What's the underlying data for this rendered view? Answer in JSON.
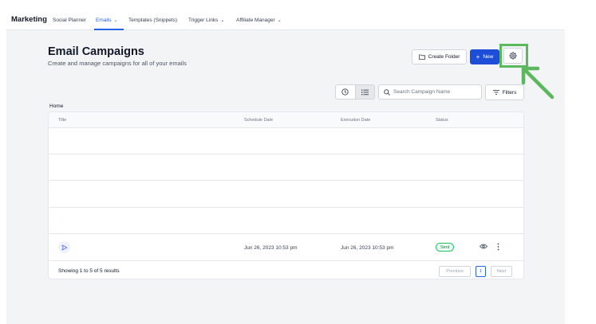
{
  "nav": {
    "brand": "Marketing",
    "items": [
      {
        "label": "Social Planner",
        "active": false,
        "has_chevron": false
      },
      {
        "label": "Emails",
        "active": true,
        "has_chevron": true
      },
      {
        "label": "Templates (Snippets)",
        "active": false,
        "has_chevron": false
      },
      {
        "label": "Trigger Links",
        "active": false,
        "has_chevron": true
      },
      {
        "label": "Affiliate Manager",
        "active": false,
        "has_chevron": true
      }
    ]
  },
  "header": {
    "title": "Email Campaigns",
    "subtitle": "Create and manage campaigns for all of your emails",
    "create_folder_label": "Create Folder",
    "new_label": "New"
  },
  "filters": {
    "search_placeholder": "Search Campaign Name",
    "filters_label": "Filters"
  },
  "breadcrumb": "Home",
  "table": {
    "columns": [
      "Title",
      "Schedule Date",
      "Execution Date",
      "Status"
    ],
    "campaign": {
      "schedule_date": "Jun 26, 2023 10:53 pm",
      "execution_date": "Jun 26, 2023 10:53 pm",
      "status": "Sent"
    }
  },
  "pagination": {
    "summary": "Showing 1 to 5 of 5 results",
    "previous_label": "Previous",
    "current_page": "1",
    "next_label": "Next"
  },
  "colors": {
    "primary": "#1d4ed8",
    "highlight": "#5cb85c",
    "status_sent": "#22c55e"
  }
}
